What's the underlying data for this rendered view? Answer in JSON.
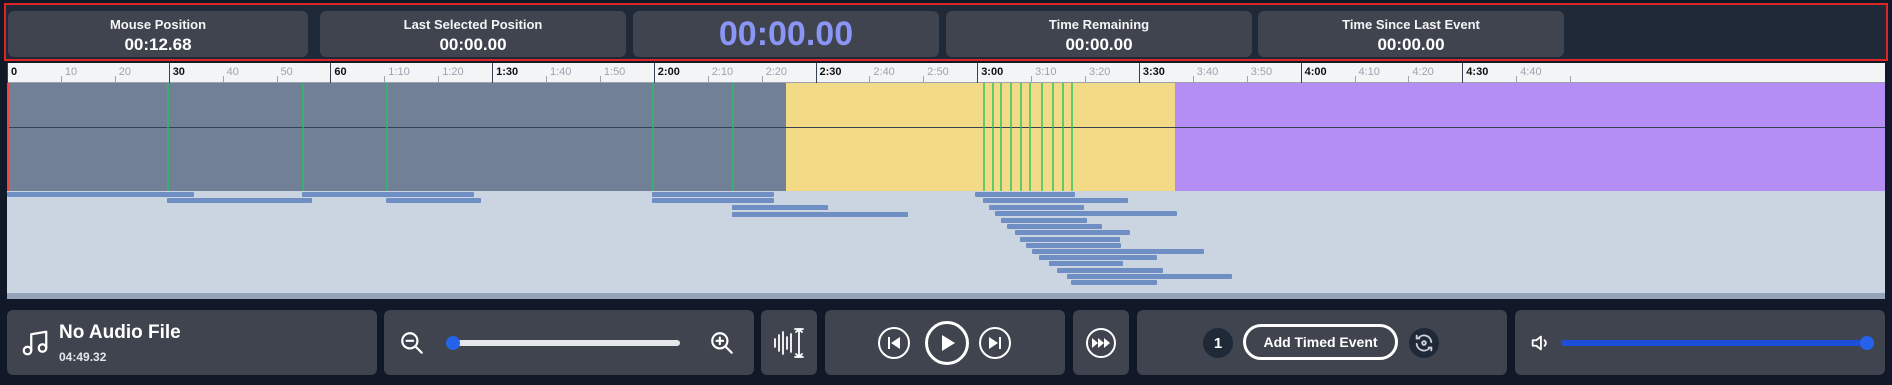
{
  "info": {
    "mouse_position_label": "Mouse Position",
    "mouse_position_value": "00:12.68",
    "last_selected_label": "Last Selected Position",
    "last_selected_value": "00:00.00",
    "current_time": "00:00.00",
    "time_remaining_label": "Time Remaining",
    "time_remaining_value": "00:00.00",
    "time_since_label": "Time Since Last Event",
    "time_since_value": "00:00.00"
  },
  "ruler": {
    "major_labels": [
      "0",
      "30",
      "60",
      "1:30",
      "2:00",
      "2:30",
      "3:00",
      "3:30",
      "4:00",
      "4:30"
    ],
    "minor_labels": [
      "10",
      "20",
      "40",
      "50",
      "1:10",
      "1:20",
      "1:40",
      "1:50",
      "2:10",
      "2:20",
      "2:40",
      "2:50",
      "3:10",
      "3:20",
      "3:40",
      "3:50",
      "4:10",
      "4:20",
      "4:40"
    ]
  },
  "timeline": {
    "colors": {
      "gray_region": "#718096",
      "yellow_region": "#f2da87",
      "purple_region": "#b48df5",
      "marker": "#22c55e",
      "event_bar": "#6f8ec4"
    }
  },
  "audio": {
    "title": "No Audio File",
    "duration": "04:49.32"
  },
  "zoom": {
    "level": 0.0
  },
  "events": {
    "count": "1",
    "add_label": "Add Timed Event"
  },
  "volume": {
    "level": 1.0
  },
  "icons": {
    "audio": "music-note-icon",
    "zoom_out": "zoom-out-icon",
    "zoom_in": "zoom-in-icon",
    "waveform": "waveform-height-icon",
    "prev": "skip-back-icon",
    "play": "play-icon",
    "next": "skip-forward-icon",
    "speed": "fast-forward-icon",
    "reset": "reset-sync-icon",
    "volume": "volume-icon"
  }
}
